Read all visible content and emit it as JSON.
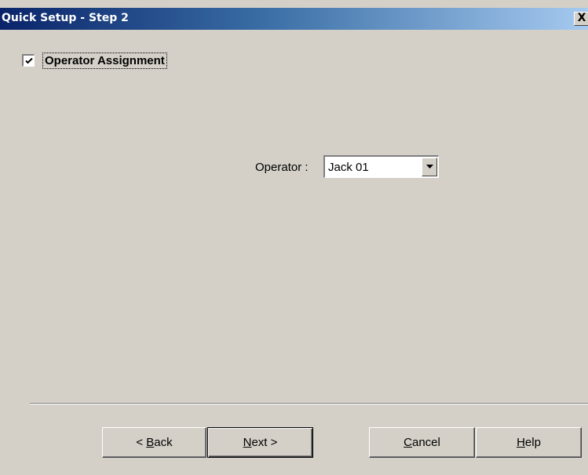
{
  "window": {
    "title": "Quick Setup - Step 2",
    "close_glyph": "X"
  },
  "operator_assignment": {
    "label": "Operator Assignment",
    "checked": true
  },
  "operator": {
    "label": "Operator :",
    "value": "Jack 01"
  },
  "buttons": {
    "back": {
      "prefix": "< ",
      "mnemonic": "B",
      "rest": "ack"
    },
    "next": {
      "mnemonic": "N",
      "rest": "ext >"
    },
    "cancel": {
      "mnemonic": "C",
      "rest": "ancel"
    },
    "help": {
      "mnemonic": "H",
      "rest": "elp"
    }
  },
  "icons": {
    "checkbox": "checkmark-icon",
    "dropdown": "dropdown-arrow-icon",
    "close": "close-icon"
  }
}
